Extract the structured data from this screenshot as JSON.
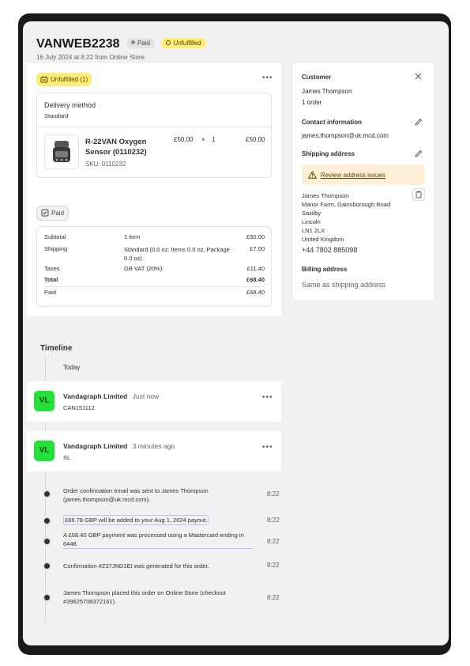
{
  "order": {
    "id": "VANWEB2238",
    "payment_badge": "Paid",
    "fulfillment_badge": "Unfulfilled",
    "subtitle": "16 July 2024 at 8:22 from Online Store"
  },
  "fulfillment": {
    "status_label": "Unfulfilled (1)",
    "delivery_method_label": "Delivery method",
    "delivery_method_value": "Standard",
    "item": {
      "name_line1": "R-22VAN Oxygen",
      "name_line2": "Sensor (0110232)",
      "sku": "SKU: 0110232",
      "unit_price": "£50.00",
      "times": "×",
      "quantity": "1",
      "total": "£50.00"
    }
  },
  "payment": {
    "status_label": "Paid",
    "rows": [
      {
        "label": "Subtotal",
        "detail": "1 item",
        "amount": "£50.00"
      },
      {
        "label": "Shipping",
        "detail": "Standard (0.0 oz: Items 0.0 oz, Package 0.0 oz)",
        "amount": "£7.00"
      },
      {
        "label": "Taxes",
        "detail": "GB VAT (20%)",
        "amount": "£11.40"
      },
      {
        "label": "Total",
        "detail": "",
        "amount": "£68.40"
      },
      {
        "label": "Paid",
        "detail": "",
        "amount": "£68.40"
      }
    ]
  },
  "customer": {
    "heading": "Customer",
    "name": "James Thompson",
    "orders": "1 order",
    "contact_heading": "Contact information",
    "email": "james.thompson@uk.mcd.com",
    "shipping_heading": "Shipping address",
    "review_link": "Review address issues",
    "address": [
      "James Thompson",
      "Manor Farm, Gainsborough Road",
      "Saxilby",
      "Lincoln",
      "LN1 2LX",
      "United Kingdom"
    ],
    "phone": "+44 7802 885098",
    "billing_heading": "Billing address",
    "billing_value": "Same as shipping address"
  },
  "timeline": {
    "heading": "Timeline",
    "today": "Today",
    "comments": [
      {
        "initials": "VL",
        "author": "Vandagraph Limited",
        "time": "Just now",
        "text": "CAN151112"
      },
      {
        "initials": "VL",
        "author": "Vandagraph Limited",
        "time": "3 minutes ago",
        "text": "SL"
      }
    ],
    "events": [
      {
        "text": "Order confirmation email was sent to James Thompson (james.thompson@uk.mcd.com).",
        "time": "8:22"
      },
      {
        "text": "£66.78 GBP will be added to your Aug 1, 2024 payout.",
        "time": "8:22"
      },
      {
        "text": "A £68.40 GBP payment was processed using a Mastercard ending in 6448.",
        "time": "8:22"
      },
      {
        "text": "Confirmation #Z37JND1EI was generated for this order.",
        "time": "8:22"
      },
      {
        "text": "James Thompson placed this order on Online Store (checkout #39625708372161).",
        "time": "8:22"
      }
    ]
  },
  "icons": {
    "more": "more-horizontal-icon",
    "close": "close-icon",
    "edit": "pencil-icon",
    "warning": "warning-icon",
    "copy": "clipboard-icon"
  },
  "colors": {
    "yellow_badge": "#ffeb78",
    "avatar_green": "#22e23a",
    "warning_bg": "#ffefd6"
  }
}
